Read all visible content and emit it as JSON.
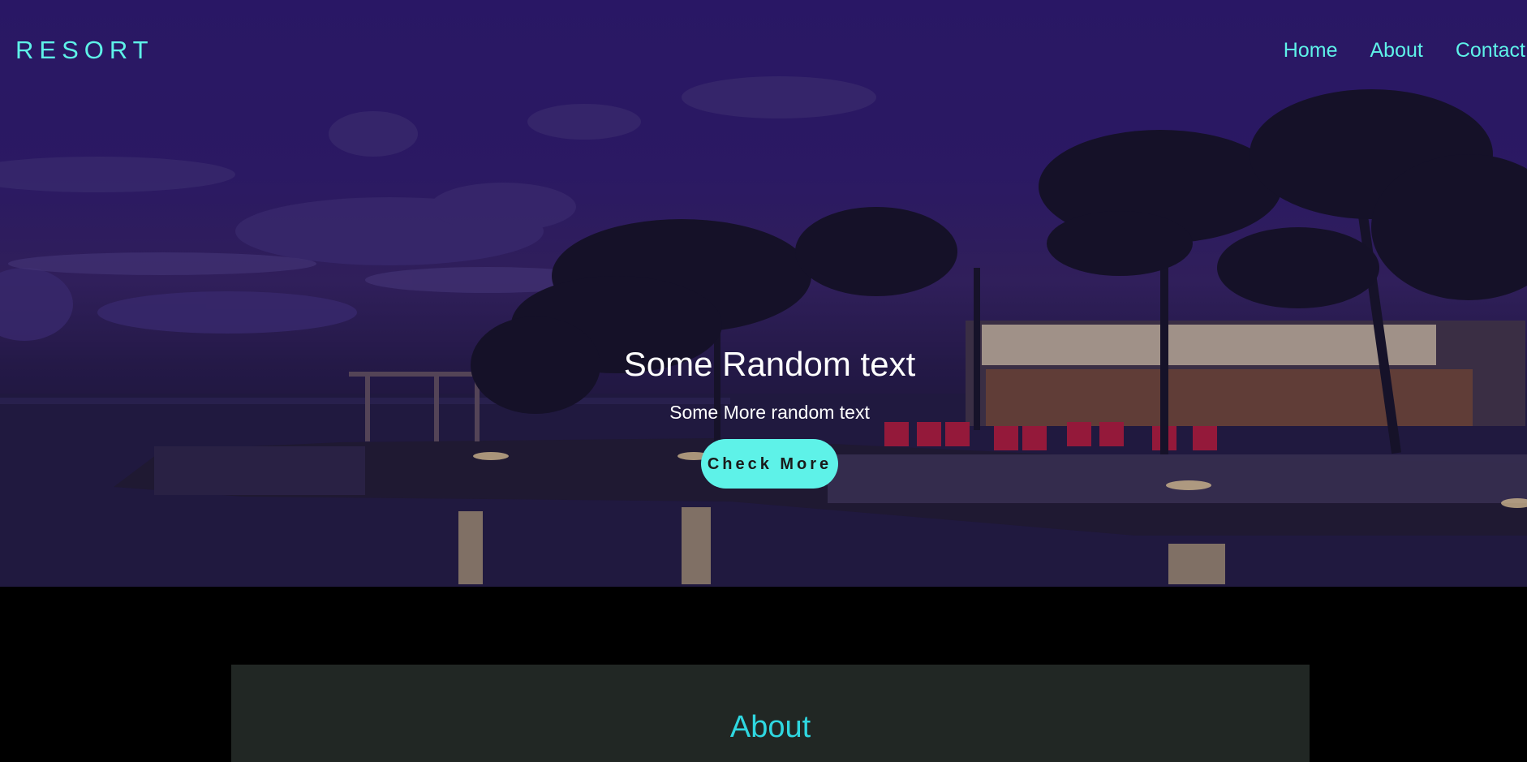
{
  "brand": {
    "name": "RESORT"
  },
  "nav": {
    "items": [
      {
        "label": "Home"
      },
      {
        "label": "About"
      },
      {
        "label": "Contact"
      }
    ]
  },
  "hero": {
    "title": "Some Random text",
    "subtitle": "Some More random text",
    "cta_label": "Check More"
  },
  "about": {
    "title": "About"
  },
  "colors": {
    "accent": "#5ef2e8",
    "page_background": "#000000",
    "card_background": "#212724",
    "hero_overlay": "#2a1766"
  }
}
